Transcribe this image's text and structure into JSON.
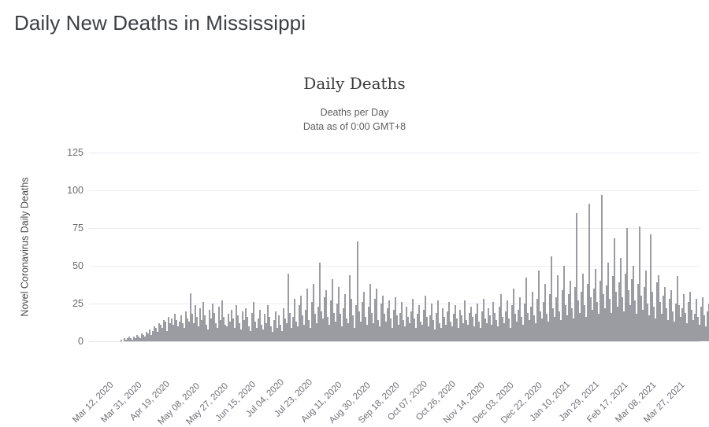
{
  "page": {
    "title": "Daily New Deaths in Mississippi"
  },
  "chart_data": {
    "type": "bar",
    "title": "Daily Deaths",
    "subtitle_lines": [
      "Deaths per Day",
      "Data as of 0:00 GMT+8"
    ],
    "xlabel": "",
    "ylabel": "Novel Coronavirus Daily Deaths",
    "ylim": [
      0,
      125
    ],
    "yticks": [
      0,
      25,
      50,
      75,
      100,
      125
    ],
    "grid": true,
    "legend": "none",
    "bar_color": "#9b9ba2",
    "x_tick_labels": [
      "Mar 12, 2020",
      "Mar 31, 2020",
      "Apr 19, 2020",
      "May 08, 2020",
      "May 27, 2020",
      "Jun 15, 2020",
      "Jul 04, 2020",
      "Jul 23, 2020",
      "Aug 11, 2020",
      "Aug 30, 2020",
      "Sep 18, 2020",
      "Oct 07, 2020",
      "Oct 26, 2020",
      "Nov 14, 2020",
      "Dec 03, 2020",
      "Dec 22, 2020",
      "Jan 10, 2021",
      "Jan 29, 2021",
      "Feb 17, 2021",
      "Mar 08, 2021",
      "Mar 27, 2021"
    ],
    "x_tick_indices": [
      0,
      19,
      38,
      57,
      76,
      95,
      114,
      133,
      152,
      171,
      190,
      209,
      228,
      247,
      266,
      285,
      304,
      323,
      342,
      361,
      380
    ],
    "x_start_date": "Mar 12, 2020",
    "x_end_date": "Apr 02, 2021",
    "values": [
      0,
      0,
      0,
      0,
      0,
      0,
      0,
      0,
      0,
      0,
      0,
      0,
      0,
      0,
      0,
      0,
      0,
      0,
      0,
      0,
      1,
      0,
      2,
      1,
      2,
      3,
      2,
      1,
      3,
      2,
      4,
      3,
      2,
      5,
      4,
      3,
      6,
      5,
      8,
      4,
      7,
      10,
      9,
      6,
      12,
      11,
      9,
      14,
      13,
      7,
      16,
      12,
      15,
      11,
      18,
      14,
      10,
      13,
      17,
      12,
      9,
      20,
      15,
      13,
      32,
      18,
      12,
      24,
      16,
      10,
      22,
      14,
      26,
      17,
      11,
      8,
      21,
      15,
      25,
      19,
      12,
      9,
      23,
      14,
      27,
      16,
      11,
      10,
      18,
      13,
      21,
      15,
      9,
      24,
      17,
      12,
      8,
      20,
      14,
      22,
      16,
      10,
      7,
      19,
      26,
      13,
      9,
      15,
      21,
      11,
      8,
      18,
      12,
      24,
      16,
      10,
      6,
      14,
      20,
      9,
      17,
      11,
      7,
      22,
      15,
      12,
      45,
      19,
      9,
      16,
      28,
      13,
      10,
      24,
      30,
      17,
      11,
      21,
      35,
      14,
      9,
      26,
      38,
      18,
      12,
      23,
      52,
      20,
      15,
      29,
      34,
      16,
      11,
      27,
      41,
      19,
      13,
      25,
      36,
      18,
      10,
      22,
      31,
      15,
      12,
      44,
      28,
      17,
      9,
      24,
      66,
      20,
      13,
      26,
      33,
      16,
      11,
      23,
      38,
      19,
      12,
      28,
      35,
      14,
      10,
      25,
      30,
      18,
      13,
      22,
      27,
      15,
      9,
      21,
      29,
      17,
      11,
      19,
      26,
      14,
      10,
      23,
      16,
      12,
      20,
      28,
      15,
      9,
      18,
      24,
      13,
      11,
      21,
      30,
      16,
      10,
      17,
      25,
      14,
      8,
      19,
      27,
      12,
      9,
      22,
      16,
      11,
      20,
      26,
      13,
      10,
      18,
      24,
      15,
      9,
      21,
      17,
      12,
      27,
      14,
      11,
      19,
      23,
      16,
      10,
      18,
      25,
      13,
      9,
      20,
      28,
      15,
      12,
      22,
      17,
      11,
      26,
      19,
      14,
      10,
      23,
      31,
      16,
      12,
      20,
      27,
      15,
      9,
      24,
      35,
      18,
      13,
      21,
      29,
      16,
      11,
      25,
      42,
      19,
      14,
      23,
      33,
      17,
      12,
      28,
      47,
      20,
      15,
      26,
      38,
      18,
      13,
      31,
      56,
      22,
      16,
      29,
      44,
      20,
      14,
      34,
      50,
      24,
      17,
      31,
      40,
      22,
      15,
      36,
      85,
      27,
      19,
      33,
      45,
      24,
      16,
      38,
      91,
      29,
      21,
      35,
      48,
      26,
      18,
      40,
      97,
      31,
      22,
      37,
      52,
      28,
      19,
      43,
      68,
      33,
      23,
      39,
      55,
      29,
      20,
      45,
      75,
      34,
      24,
      41,
      50,
      27,
      18,
      38,
      76,
      30,
      21,
      36,
      47,
      25,
      17,
      71,
      33,
      23,
      15,
      39,
      44,
      26,
      18,
      30,
      36,
      22,
      14,
      28,
      34,
      20,
      13,
      25,
      43,
      24,
      16,
      22,
      31,
      19,
      12,
      26,
      33,
      21,
      14,
      18,
      28,
      16,
      11,
      23,
      29,
      17,
      10,
      20,
      25,
      13,
      8,
      18,
      22,
      12,
      15,
      9,
      14,
      19,
      6,
      11,
      20
    ]
  }
}
